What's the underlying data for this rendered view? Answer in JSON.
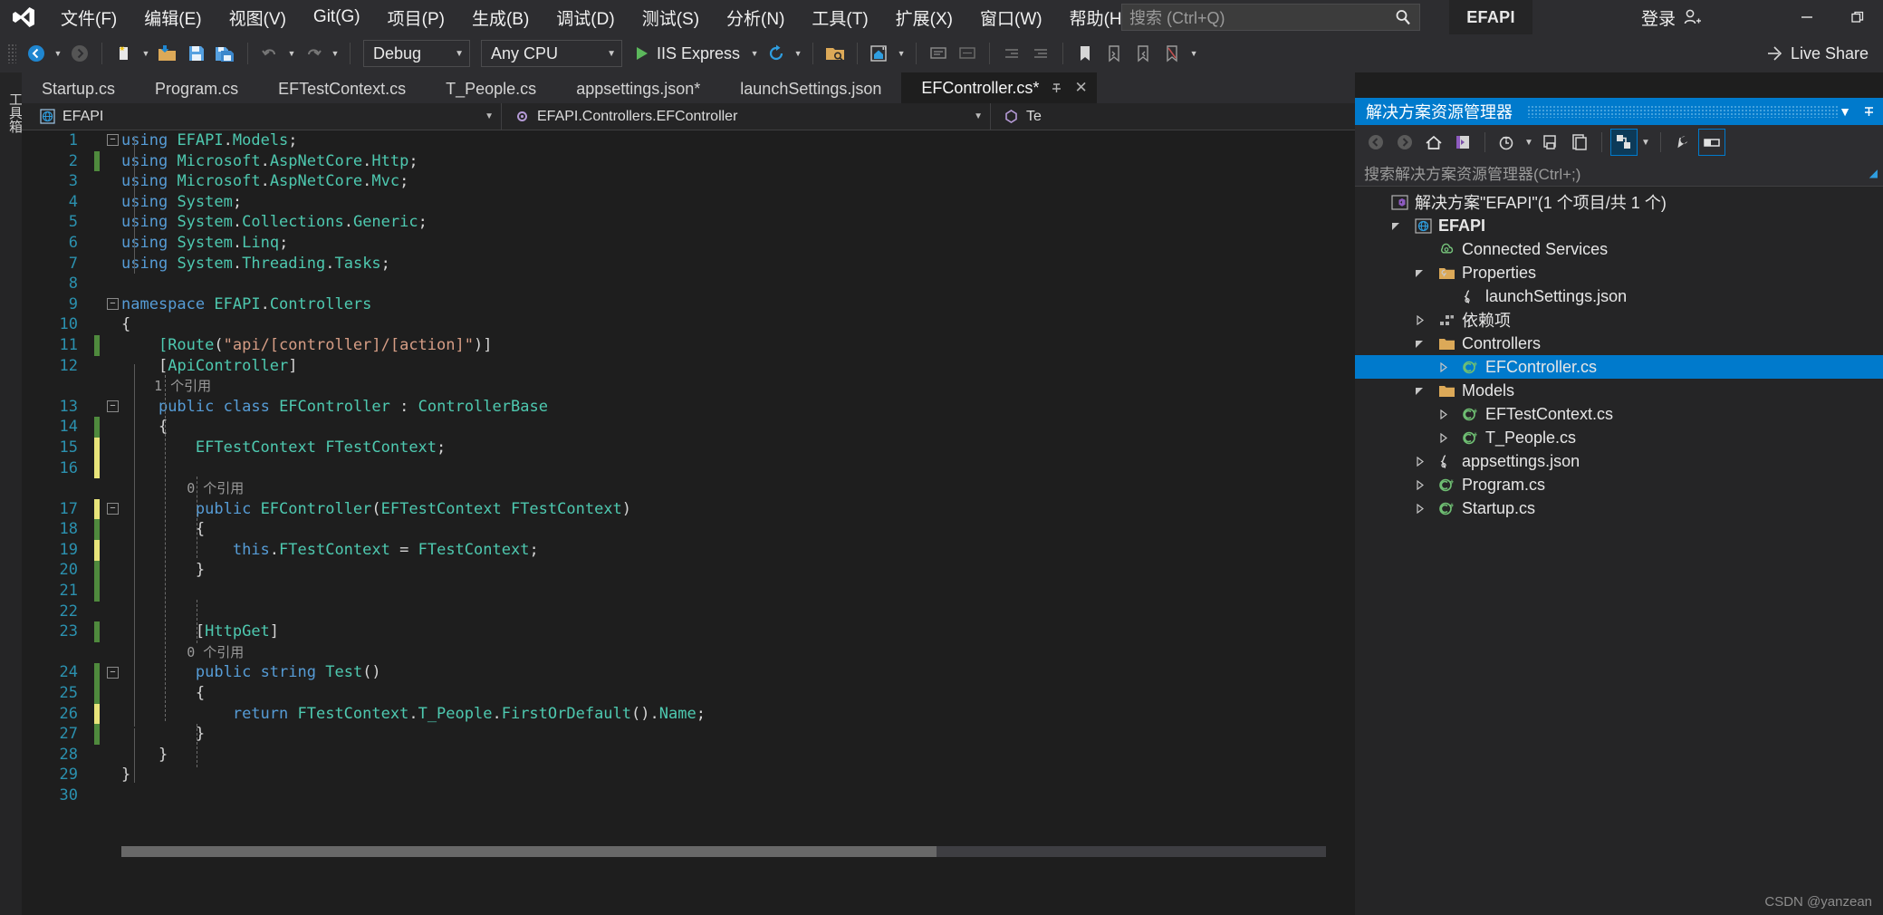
{
  "window": {
    "project_badge": "EFAPI",
    "signin_label": "登录",
    "minimize": "—",
    "restore": "❐"
  },
  "menu": {
    "items": [
      {
        "label": "文件(F)",
        "name": "menu-file"
      },
      {
        "label": "编辑(E)",
        "name": "menu-edit"
      },
      {
        "label": "视图(V)",
        "name": "menu-view"
      },
      {
        "label": "Git(G)",
        "name": "menu-git"
      },
      {
        "label": "项目(P)",
        "name": "menu-project"
      },
      {
        "label": "生成(B)",
        "name": "menu-build"
      },
      {
        "label": "调试(D)",
        "name": "menu-debug"
      },
      {
        "label": "测试(S)",
        "name": "menu-test"
      },
      {
        "label": "分析(N)",
        "name": "menu-analyze"
      },
      {
        "label": "工具(T)",
        "name": "menu-tools"
      },
      {
        "label": "扩展(X)",
        "name": "menu-extensions"
      },
      {
        "label": "窗口(W)",
        "name": "menu-window"
      },
      {
        "label": "帮助(H)",
        "name": "menu-help"
      }
    ]
  },
  "search": {
    "placeholder": "搜索 (Ctrl+Q)"
  },
  "toolbar": {
    "configuration": "Debug",
    "platform": "Any CPU",
    "run_target": "IIS Express",
    "live_share": "Live Share"
  },
  "vertical_strip": {
    "label": "工具箱"
  },
  "tabs": [
    {
      "label": "Startup.cs",
      "active": false,
      "dirty": false
    },
    {
      "label": "Program.cs",
      "active": false,
      "dirty": false
    },
    {
      "label": "EFTestContext.cs",
      "active": false,
      "dirty": false
    },
    {
      "label": "T_People.cs",
      "active": false,
      "dirty": false
    },
    {
      "label": "appsettings.json*",
      "active": false,
      "dirty": true
    },
    {
      "label": "launchSettings.json",
      "active": false,
      "dirty": false
    },
    {
      "label": "EFController.cs*",
      "active": true,
      "dirty": true
    }
  ],
  "context_bar": {
    "project": "EFAPI",
    "type": "EFAPI.Controllers.EFController",
    "member": "Te"
  },
  "code": {
    "lines": [
      {
        "n": 1,
        "text": "using EFAPI.Models;",
        "mark": "",
        "fold": "minus"
      },
      {
        "n": 2,
        "text": "using Microsoft.AspNetCore.Http;",
        "mark": "green"
      },
      {
        "n": 3,
        "text": "using Microsoft.AspNetCore.Mvc;",
        "mark": ""
      },
      {
        "n": 4,
        "text": "using System;",
        "mark": ""
      },
      {
        "n": 5,
        "text": "using System.Collections.Generic;",
        "mark": ""
      },
      {
        "n": 6,
        "text": "using System.Linq;",
        "mark": ""
      },
      {
        "n": 7,
        "text": "using System.Threading.Tasks;",
        "mark": ""
      },
      {
        "n": 8,
        "text": "",
        "mark": ""
      },
      {
        "n": 9,
        "text": "namespace EFAPI.Controllers",
        "mark": "",
        "fold": "minus"
      },
      {
        "n": 10,
        "text": "{",
        "mark": ""
      },
      {
        "n": 11,
        "text": "    [Route(\"api/[controller]/[action]\")]",
        "mark": "green"
      },
      {
        "n": 12,
        "text": "    [ApiController]",
        "mark": ""
      },
      {
        "n": "",
        "text": "    1 个引用",
        "mark": "",
        "ref": true
      },
      {
        "n": 13,
        "text": "    public class EFController : ControllerBase",
        "mark": "",
        "fold": "minus"
      },
      {
        "n": 14,
        "text": "    {",
        "mark": "green"
      },
      {
        "n": 15,
        "text": "        EFTestContext FTestContext;",
        "mark": "yellow"
      },
      {
        "n": 16,
        "text": "",
        "mark": "yellow"
      },
      {
        "n": "",
        "text": "        0 个引用",
        "mark": "",
        "ref": true
      },
      {
        "n": 17,
        "text": "        public EFController(EFTestContext FTestContext)",
        "mark": "yellow",
        "fold": "minus"
      },
      {
        "n": 18,
        "text": "        {",
        "mark": "green"
      },
      {
        "n": 19,
        "text": "            this.FTestContext = FTestContext;",
        "mark": "yellow"
      },
      {
        "n": 20,
        "text": "        }",
        "mark": "green"
      },
      {
        "n": 21,
        "text": "",
        "mark": "green"
      },
      {
        "n": 22,
        "text": "",
        "mark": ""
      },
      {
        "n": 23,
        "text": "        [HttpGet]",
        "mark": "green"
      },
      {
        "n": "",
        "text": "        0 个引用",
        "mark": "",
        "ref": true
      },
      {
        "n": 24,
        "text": "        public string Test()",
        "mark": "green",
        "fold": "minus"
      },
      {
        "n": 25,
        "text": "        {",
        "mark": "green"
      },
      {
        "n": 26,
        "text": "            return FTestContext.T_People.FirstOrDefault().Name;",
        "mark": "yellow"
      },
      {
        "n": 27,
        "text": "        }",
        "mark": "green"
      },
      {
        "n": 28,
        "text": "    }",
        "mark": ""
      },
      {
        "n": 29,
        "text": "}",
        "mark": ""
      },
      {
        "n": 30,
        "text": "",
        "mark": ""
      }
    ]
  },
  "solution_explorer": {
    "title": "解决方案资源管理器",
    "search_placeholder": "搜索解决方案资源管理器(Ctrl+;)",
    "tree": [
      {
        "label": "解决方案\"EFAPI\"(1 个项目/共 1 个)",
        "indent": 0,
        "arrow": "",
        "icon": "solution-icon",
        "bold": false,
        "selected": false
      },
      {
        "label": "EFAPI",
        "indent": 1,
        "arrow": "down",
        "icon": "project-web-icon",
        "bold": true,
        "selected": false
      },
      {
        "label": "Connected Services",
        "indent": 2,
        "arrow": "",
        "icon": "connected-services-icon",
        "bold": false,
        "selected": false
      },
      {
        "label": "Properties",
        "indent": 2,
        "arrow": "down",
        "icon": "properties-folder-icon",
        "bold": false,
        "selected": false
      },
      {
        "label": "launchSettings.json",
        "indent": 3,
        "arrow": "",
        "icon": "json-icon",
        "bold": false,
        "selected": false
      },
      {
        "label": "依赖项",
        "indent": 2,
        "arrow": "right",
        "icon": "dependencies-icon",
        "bold": false,
        "selected": false
      },
      {
        "label": "Controllers",
        "indent": 2,
        "arrow": "down",
        "icon": "folder-icon",
        "bold": false,
        "selected": false
      },
      {
        "label": "EFController.cs",
        "indent": 3,
        "arrow": "right",
        "icon": "csharp-icon",
        "bold": false,
        "selected": true
      },
      {
        "label": "Models",
        "indent": 2,
        "arrow": "down",
        "icon": "folder-icon",
        "bold": false,
        "selected": false
      },
      {
        "label": "EFTestContext.cs",
        "indent": 3,
        "arrow": "right",
        "icon": "csharp-icon",
        "bold": false,
        "selected": false
      },
      {
        "label": "T_People.cs",
        "indent": 3,
        "arrow": "right",
        "icon": "csharp-icon",
        "bold": false,
        "selected": false
      },
      {
        "label": "appsettings.json",
        "indent": 2,
        "arrow": "right",
        "icon": "json-icon",
        "bold": false,
        "selected": false
      },
      {
        "label": "Program.cs",
        "indent": 2,
        "arrow": "right",
        "icon": "csharp-icon",
        "bold": false,
        "selected": false
      },
      {
        "label": "Startup.cs",
        "indent": 2,
        "arrow": "right",
        "icon": "csharp-icon",
        "bold": false,
        "selected": false
      }
    ]
  },
  "watermark": "CSDN @yanzean",
  "colors": {
    "accent": "#007acc",
    "titlebar": "#2d2d30",
    "editor_bg": "#1e1e1e",
    "panel_bg": "#252526",
    "keyword": "#569cd6",
    "type": "#4ec9b0",
    "string": "#d69d85"
  }
}
